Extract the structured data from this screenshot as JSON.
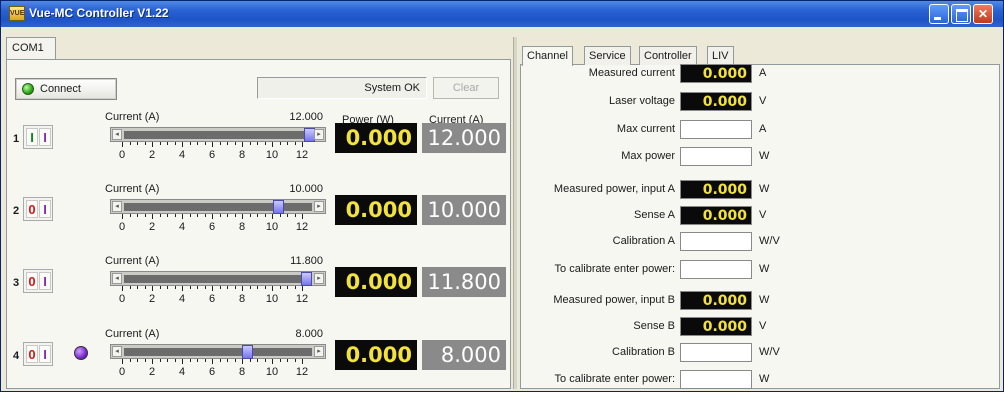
{
  "window": {
    "title": "Vue-MC Controller V1.22",
    "app_icon": "vue-app-icon"
  },
  "left": {
    "tab_label": "COM1",
    "connect_label": "Connect",
    "status_text": "System OK",
    "clear_label": "Clear",
    "header_power": "Power (W)",
    "header_current": "Current (A)",
    "tick_labels": [
      "0",
      "2",
      "4",
      "6",
      "8",
      "10",
      "12"
    ],
    "channels": [
      {
        "number": "1",
        "bit_a": "I",
        "bit_a_state": "on",
        "bit_b": "I",
        "current_label": "Current (A)",
        "setpoint": "12.000",
        "power": "0.000",
        "current": "12.000",
        "slider_fraction": 1.0
      },
      {
        "number": "2",
        "bit_a": "0",
        "bit_a_state": "off",
        "bit_b": "I",
        "current_label": "Current (A)",
        "setpoint": "10.000",
        "power": "0.000",
        "current": "10.000",
        "slider_fraction": 0.8333
      },
      {
        "number": "3",
        "bit_a": "0",
        "bit_a_state": "off",
        "bit_b": "I",
        "current_label": "Current (A)",
        "setpoint": "11.800",
        "power": "0.000",
        "current": "11.800",
        "slider_fraction": 0.9833
      },
      {
        "number": "4",
        "bit_a": "0",
        "bit_a_state": "off",
        "bit_b": "I",
        "current_label": "Current (A)",
        "setpoint": "8.000",
        "power": "0.000",
        "current": "8.000",
        "slider_fraction": 0.6667
      }
    ]
  },
  "right": {
    "tabs": [
      "Channel",
      "Service",
      "Controller",
      "LIV"
    ],
    "active_tab": "Channel",
    "fields": [
      {
        "label": "Measured current",
        "value": "0.000",
        "unit": "A",
        "dark": true
      },
      {
        "label": "Laser voltage",
        "value": "0.000",
        "unit": "V",
        "dark": true
      },
      {
        "label": "Max current",
        "value": "",
        "unit": "A",
        "dark": false
      },
      {
        "label": "Max power",
        "value": "",
        "unit": "W",
        "dark": false
      },
      {
        "label": "Measured power, input A",
        "value": "0.000",
        "unit": "W",
        "dark": true
      },
      {
        "label": "Sense A",
        "value": "0.000",
        "unit": "V",
        "dark": true
      },
      {
        "label": "Calibration A",
        "value": "",
        "unit": "W/V",
        "dark": false
      },
      {
        "label": "To calibrate enter power:",
        "value": "",
        "unit": "W",
        "dark": false
      },
      {
        "label": "Measured power, input B",
        "value": "0.000",
        "unit": "W",
        "dark": true
      },
      {
        "label": "Sense B",
        "value": "0.000",
        "unit": "V",
        "dark": true
      },
      {
        "label": "Calibration B",
        "value": "",
        "unit": "W/V",
        "dark": false
      },
      {
        "label": "To calibrate enter power:",
        "value": "",
        "unit": "W",
        "dark": false
      }
    ]
  },
  "colors": {
    "titlebar": "#2a63d4",
    "display_bg": "#0a0a0a",
    "display_text": "#f2e23a",
    "current_display_bg": "#8a8a8a",
    "on_bit": "#0a8a1a",
    "off_bit": "#d01818"
  }
}
